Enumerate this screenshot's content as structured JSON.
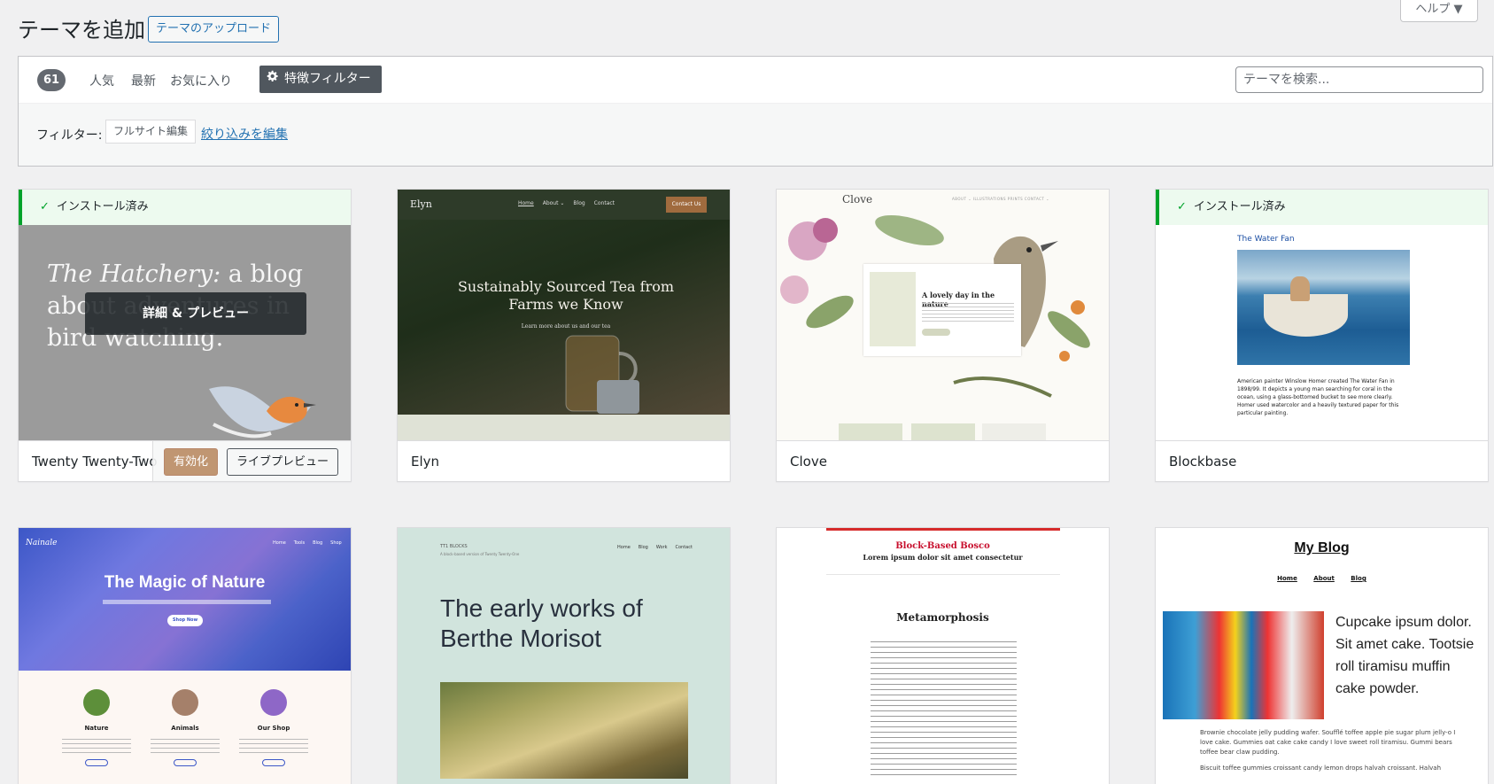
{
  "header": {
    "title": "テーマを追加",
    "upload_label": "テーマのアップロード",
    "help_label": "ヘルプ ▼"
  },
  "filters": {
    "count": "61",
    "tabs": [
      "人気",
      "最新",
      "お気に入り"
    ],
    "feature_filter_label": "特徴フィルター",
    "search_placeholder": "テーマを検索...",
    "filter_label": "フィルター:",
    "active_tag": "フルサイト編集",
    "edit_link": "絞り込みを編集"
  },
  "themes": [
    {
      "name": "Twenty Twenty-Two",
      "installed_label": "インストール済み",
      "details_label": "詳細 & プレビュー",
      "activate_label": "有効化",
      "live_preview_label": "ライブプレビュー",
      "preview": {
        "heading_italic": "The Hatchery:",
        "heading_rest": " a blog about adventures in bird watching."
      }
    },
    {
      "name": "Elyn",
      "preview": {
        "logo": "Elyn",
        "nav": [
          "Home",
          "About ⌄",
          "Blog",
          "Contact"
        ],
        "cta": "Contact Us",
        "title": "Sustainably Sourced Tea from Farms we Know",
        "subtitle": "Learn more about us and our tea"
      }
    },
    {
      "name": "Clove",
      "preview": {
        "logo": "Clove",
        "nav": "ABOUT ⌄   ILLUSTRATIONS   PRINTS   CONTACT ⌄",
        "card_title": "A lovely day in the nature"
      }
    },
    {
      "name": "Blockbase",
      "installed_label": "インストール済み",
      "preview": {
        "title": "The Water Fan",
        "text": "American painter Winslow Homer created The Water Fan in 1898/99. It depicts a young man searching for coral in the ocean, using a glass-bottomed bucket to see more clearly. Homer used watercolor and a heavily textured paper for this particular painting."
      }
    },
    {
      "preview": {
        "logo": "Nainale",
        "nav": [
          "Home",
          "Tools",
          "Blog",
          "Shop"
        ],
        "title": "The Magic of Nature",
        "button": "Shop Now",
        "columns": [
          "Nature",
          "Animals",
          "Our Shop"
        ]
      }
    },
    {
      "preview": {
        "meta1": "TT1 BLOCKS",
        "meta2": "A block-based version of Twenty Twenty-One",
        "nav": [
          "Home",
          "Blog",
          "Work",
          "Contact"
        ],
        "title": "The early works of Berthe Morisot"
      }
    },
    {
      "preview": {
        "title": "Block-Based Bosco",
        "subtitle": "Lorem ipsum dolor sit amet consectetur",
        "heading": "Metamorphosis"
      }
    },
    {
      "preview": {
        "title": "My Blog",
        "nav": [
          "Home",
          "About",
          "Blog"
        ],
        "text": "Cupcake ipsum dolor. Sit amet cake. Tootsie roll tiramisu muffin cake powder.",
        "para1": "Brownie chocolate jelly pudding wafer. Soufflé toffee apple pie sugar plum jelly-o I love cake. Gummies oat cake cake candy I love sweet roll tiramisu. Gummi bears toffee bear claw pudding.",
        "para2": "Biscuit toffee gummies croissant candy lemon drops halvah croissant. Halvah"
      }
    }
  ],
  "colors": {
    "accent": "#2271b1",
    "installed_green": "#00a32a",
    "activate_button": "#c09672"
  }
}
